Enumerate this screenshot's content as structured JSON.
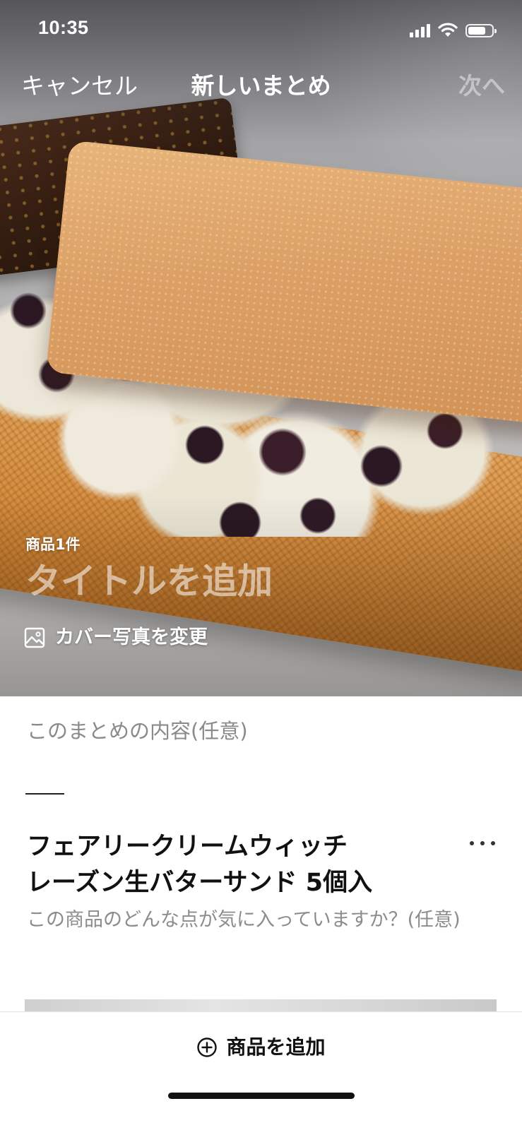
{
  "status_bar": {
    "time": "10:35",
    "signal_icon": "cellular-signal-icon",
    "wifi_icon": "wifi-icon",
    "battery_icon": "battery-icon",
    "battery_level": 0.75
  },
  "nav": {
    "cancel_label": "キャンセル",
    "title": "新しいまとめ",
    "next_label": "次へ"
  },
  "cover": {
    "item_count": "商品1件",
    "title_placeholder": "タイトルを追加",
    "change_cover_icon": "image-icon",
    "change_cover_label": "カバー写真を変更"
  },
  "summary": {
    "description_placeholder": "このまとめの内容(任意)",
    "description_value": ""
  },
  "products": [
    {
      "name_lines": [
        "フェアリークリームウィッチ",
        "レーズン生バターサンド 5個入"
      ],
      "more_icon": "more-horizontal-icon",
      "comment_placeholder": "この商品のどんな点が気に入っていますか？(任意)"
    }
  ],
  "bottom_bar": {
    "add_icon": "plus-circle-icon",
    "add_label": "商品を追加"
  },
  "colors": {
    "text_primary": "#111111",
    "placeholder": "#8a8a8a",
    "disabled_next": "#ffffff73",
    "divider": "#e2e2e2"
  }
}
